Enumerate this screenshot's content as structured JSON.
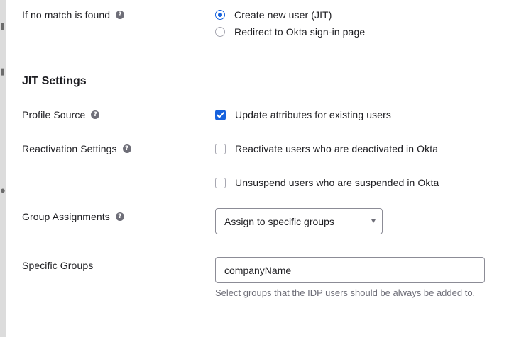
{
  "no_match": {
    "label": "If no match is found",
    "options": [
      {
        "label": "Create new user (JIT)",
        "selected": true
      },
      {
        "label": "Redirect to Okta sign-in page",
        "selected": false
      }
    ]
  },
  "jit": {
    "title": "JIT Settings",
    "profile_source": {
      "label": "Profile Source",
      "checkbox_label": "Update attributes for existing users",
      "checked": true
    },
    "reactivation": {
      "label": "Reactivation Settings",
      "options": [
        {
          "label": "Reactivate users who are deactivated in Okta",
          "checked": false
        },
        {
          "label": "Unsuspend users who are suspended in Okta",
          "checked": false
        }
      ]
    },
    "group_assignments": {
      "label": "Group Assignments",
      "selected": "Assign to specific groups"
    },
    "specific_groups": {
      "label": "Specific Groups",
      "value": "companyName",
      "hint": "Select groups that the IDP users should be always be added to."
    }
  },
  "colors": {
    "accent": "#1662dd",
    "text": "#1d1d21",
    "muted": "#6e6e78"
  }
}
